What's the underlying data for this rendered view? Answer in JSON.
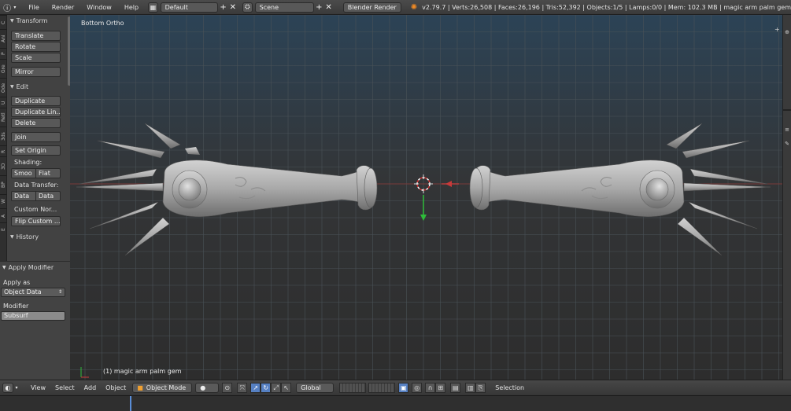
{
  "topbar": {
    "menus": [
      "File",
      "Render",
      "Window",
      "Help"
    ],
    "screen_layout": "Default",
    "scene": "Scene",
    "engine": "Blender Render",
    "stats": "v2.79.7 | Verts:26,508 | Faces:26,196 | Tris:52,392 | Objects:1/5 | Lamps:0/0 | Mem: 102.3 MB | magic arm palm gem"
  },
  "tabs": [
    "C",
    "Ani",
    "P",
    "Gre",
    "Ode",
    "U",
    "Retl",
    "3ds",
    "R",
    "3D",
    "BP",
    "W",
    "A",
    "E"
  ],
  "tool_panel": {
    "transform_header": "Transform",
    "translate": "Translate",
    "rotate": "Rotate",
    "scale": "Scale",
    "mirror": "Mirror",
    "edit_header": "Edit",
    "duplicate": "Duplicate",
    "duplicate_linked": "Duplicate Lin...",
    "delete": "Delete",
    "join": "Join",
    "set_origin": "Set Origin",
    "shading_label": "Shading:",
    "smooth": "Smoo",
    "flat": "Flat",
    "data_transfer_label": "Data Transfer:",
    "data1": "Data",
    "data2": "Data",
    "custom_normals_label": "Custom Nor...",
    "flip_custom": "Flip Custom ...",
    "history_header": "History"
  },
  "operator_panel": {
    "header": "Apply Modifier",
    "apply_as_label": "Apply as",
    "apply_as_value": "Object Data",
    "modifier_label": "Modifier",
    "modifier_value": "Subsurf"
  },
  "viewport": {
    "view_name": "Bottom Ortho",
    "object_info": "(1) magic arm palm gem"
  },
  "bottombar": {
    "menus": [
      "View",
      "Select",
      "Add",
      "Object"
    ],
    "mode": "Object Mode",
    "orientation": "Global",
    "selection_label": "Selection"
  },
  "colors": {
    "accent_blue": "#5680c2",
    "axis_red": "#b43c3c",
    "axis_green": "#2ebc3a",
    "mesh_gray": "#b4b4b4",
    "timeline_cursor": "#5a8ed8"
  }
}
